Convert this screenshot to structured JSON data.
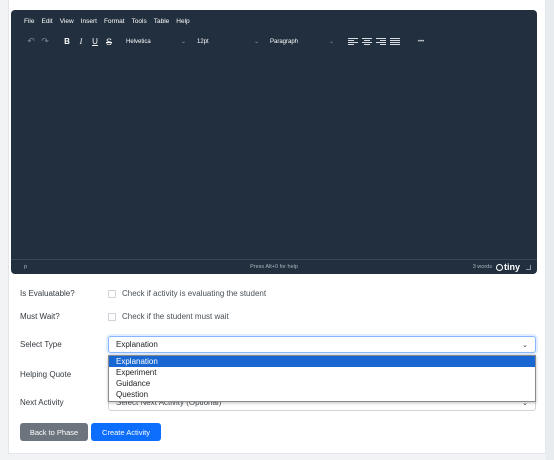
{
  "editor": {
    "menu": [
      "File",
      "Edit",
      "View",
      "Insert",
      "Format",
      "Tools",
      "Table",
      "Help"
    ],
    "font_family": "Helvetica",
    "font_size": "12pt",
    "block_format": "Paragraph",
    "more_glyph": "•••",
    "status_path": "p",
    "status_hint": "Press Alt+0 for help",
    "word_count": "3 words",
    "brand": "tiny"
  },
  "form": {
    "evaluatable_label": "Is Evaluatable?",
    "evaluatable_check_text": "Check if activity is evaluating the student",
    "must_wait_label": "Must Wait?",
    "must_wait_check_text": "Check if the student must wait",
    "select_type_label": "Select Type",
    "select_type_value": "Explanation",
    "type_options": [
      "Explanation",
      "Experiment",
      "Guidance",
      "Question"
    ],
    "helping_quote_label": "Helping Quote",
    "next_activity_label": "Next Activity",
    "next_activity_value": "Select Next Activity (Optional)"
  },
  "buttons": {
    "back": "Back to Phase",
    "create": "Create Activity"
  },
  "colors": {
    "editor_bg": "#222f3e",
    "primary": "#0d6efd",
    "secondary": "#6c757d",
    "option_highlight": "#1967d2"
  }
}
